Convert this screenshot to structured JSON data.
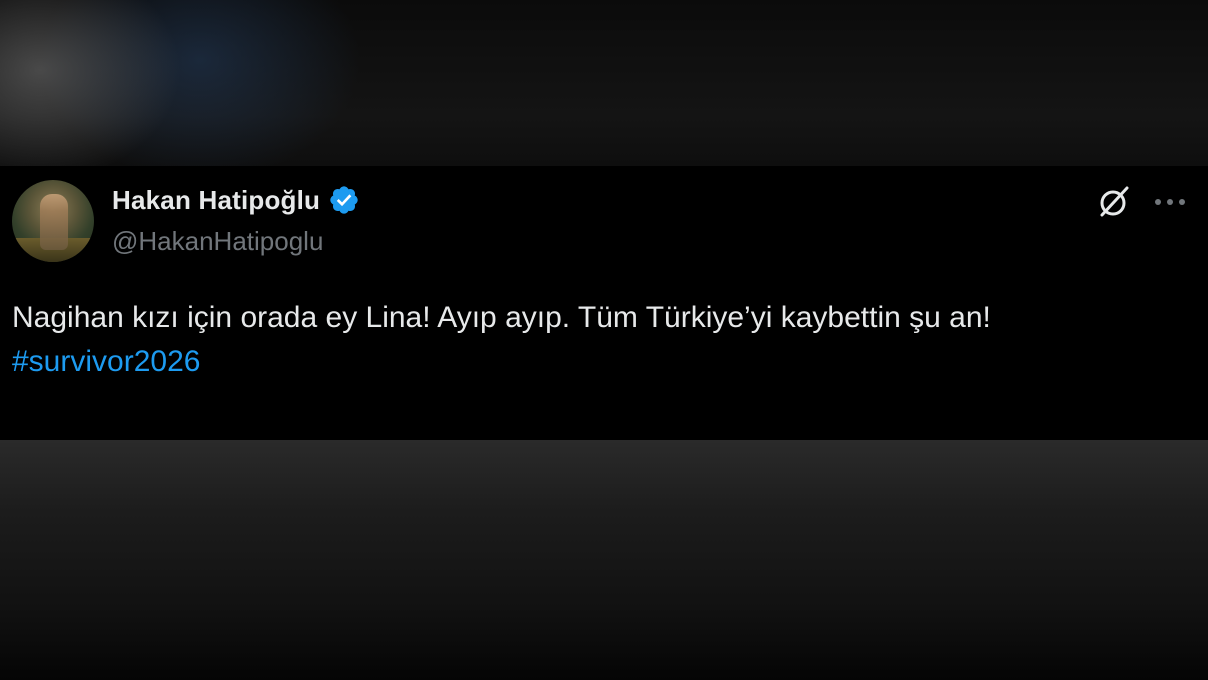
{
  "tweet": {
    "display_name": "Hakan Hatipoğlu",
    "handle": "@HakanHatipoglu",
    "text": "Nagihan kızı için orada ey Lina! Ayıp ayıp. Tüm Türkiye’yi kaybettin şu an!",
    "hashtag": "#survivor2026",
    "verified_icon": "verified-badge-icon",
    "grok_icon": "grok-icon",
    "more_icon": "more-options-icon"
  },
  "colors": {
    "background": "#000000",
    "text": "#e7e9ea",
    "secondary_text": "#71767b",
    "accent": "#1d9bf0"
  }
}
